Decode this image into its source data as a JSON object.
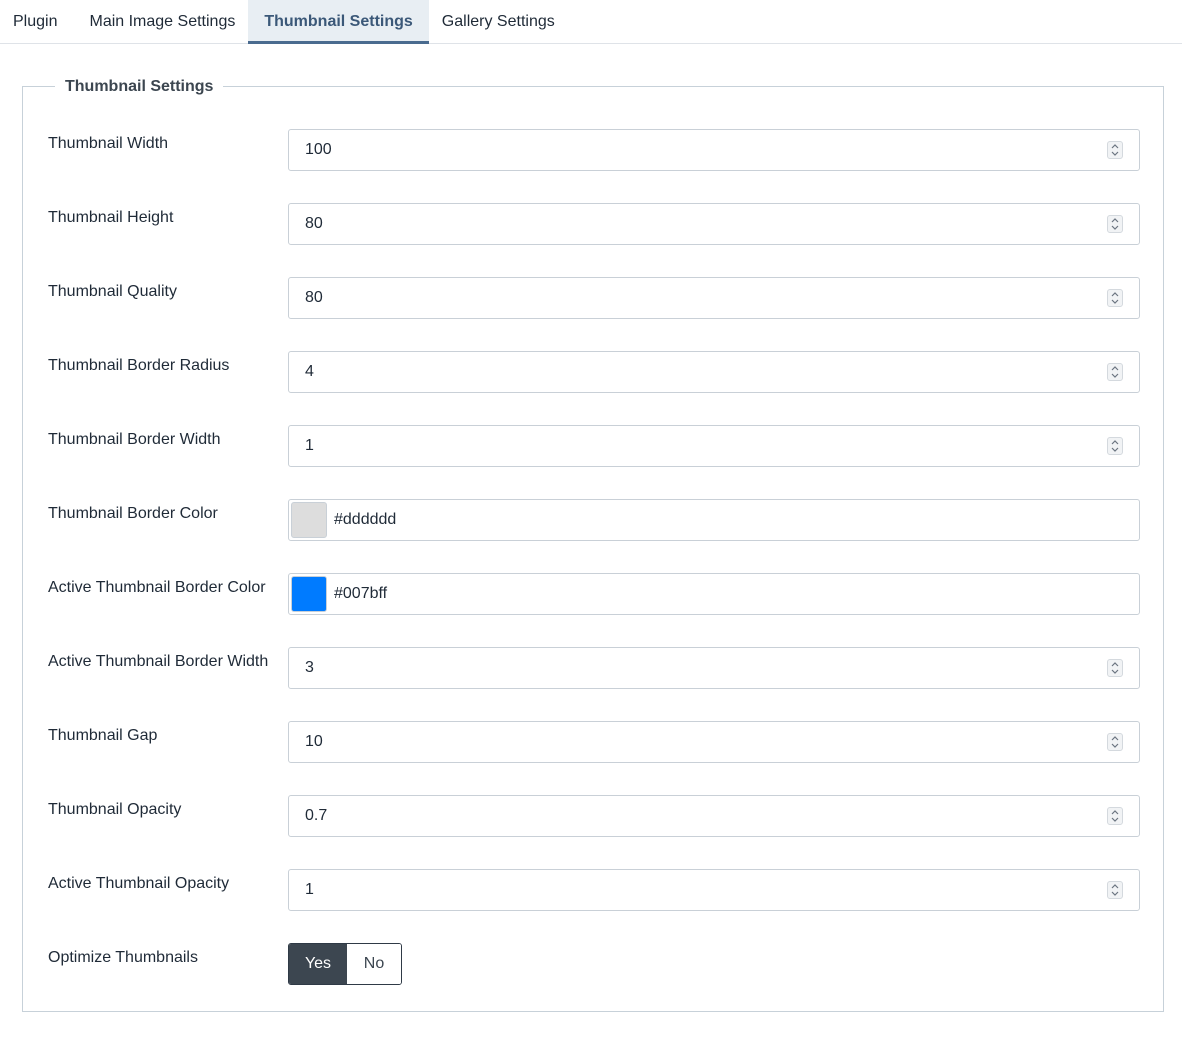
{
  "tabs": [
    {
      "label": "Plugin"
    },
    {
      "label": "Main Image Settings"
    },
    {
      "label": "Thumbnail Settings"
    },
    {
      "label": "Gallery Settings"
    }
  ],
  "active_tab": "Thumbnail Settings",
  "fieldset": {
    "legend": "Thumbnail Settings",
    "fields": [
      {
        "label": "Thumbnail Width",
        "value": "100"
      },
      {
        "label": "Thumbnail Height",
        "value": "80"
      },
      {
        "label": "Thumbnail Quality",
        "value": "80"
      },
      {
        "label": "Thumbnail Border Radius",
        "value": "4"
      },
      {
        "label": "Thumbnail Border Width",
        "value": "1"
      },
      {
        "label": "Thumbnail Border Color",
        "value": "#dddddd",
        "swatch_color": "#dddddd"
      },
      {
        "label": "Active Thumbnail Border Color",
        "value": "#007bff",
        "swatch_color": "#007bff"
      },
      {
        "label": "Active Thumbnail Border Width",
        "value": "3"
      },
      {
        "label": "Thumbnail Gap",
        "value": "10"
      },
      {
        "label": "Thumbnail Opacity",
        "value": "0.7"
      },
      {
        "label": "Active Thumbnail Opacity",
        "value": "1"
      },
      {
        "label": "Optimize Thumbnails",
        "yes_label": "Yes",
        "no_label": "No",
        "selected": "Yes"
      }
    ]
  },
  "colors": {
    "active_tab_text": "#3b5878",
    "active_tab_underline": "#4a6b8f",
    "toggle_selected_bg": "#3c4650"
  }
}
